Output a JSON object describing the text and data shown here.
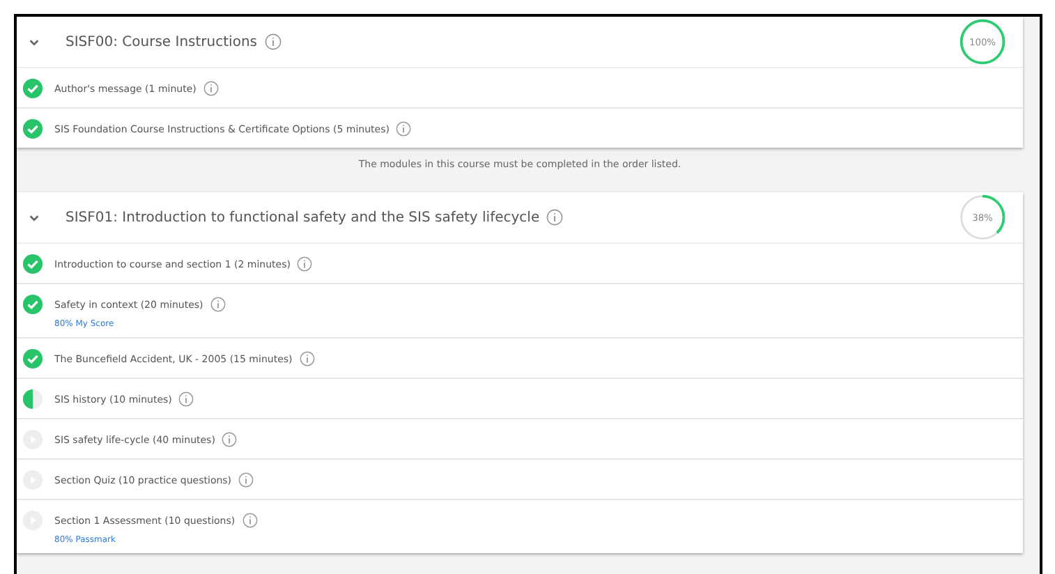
{
  "modules": [
    {
      "title": "SISF00: Course Instructions",
      "expanded": true,
      "progress": {
        "level": 1,
        "label": "100%"
      },
      "lessons": [
        {
          "kind": "done",
          "title": "Author's message (1 minute)"
        },
        {
          "kind": "done",
          "title": "SIS Foundation Course Instructions & Certificate Options (5 minutes)"
        }
      ],
      "notice": "The modules in this course must be completed in the order listed."
    },
    {
      "title": "SISF01: Introduction to functional safety and the SIS safety lifecycle",
      "expanded": true,
      "progress": {
        "level": 0.38,
        "label": "38%"
      },
      "lessons": [
        {
          "kind": "done",
          "title": "Introduction to course and section 1 (2 minutes)"
        },
        {
          "kind": "done",
          "title": "Safety in context (20 minutes)",
          "link": "80% My Score"
        },
        {
          "kind": "done",
          "title": "The Buncefield Accident, UK - 2005 (15 minutes)"
        },
        {
          "kind": "partial",
          "title": "SIS history (10 minutes)"
        },
        {
          "kind": "locked",
          "title": "SIS safety life-cycle (40 minutes)"
        },
        {
          "kind": "locked",
          "title": "Section Quiz (10 practice questions)"
        },
        {
          "kind": "locked",
          "title": "Section 1 Assessment (10 questions)",
          "link": "80% Passmark"
        }
      ]
    }
  ]
}
